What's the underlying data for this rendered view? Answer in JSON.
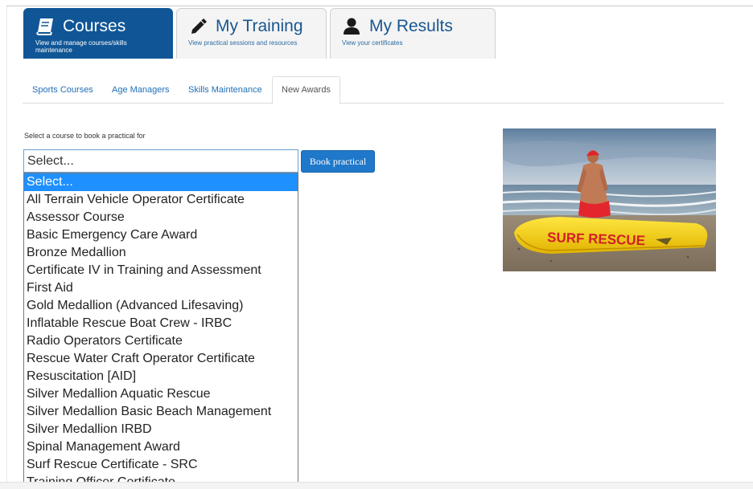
{
  "main_tabs": [
    {
      "title": "Courses",
      "subtitle": "View and manage courses/skills maintenance",
      "icon": "book-icon",
      "active": true
    },
    {
      "title": "My Training",
      "subtitle": "View practical sessions and resources",
      "icon": "pencil-icon",
      "active": false
    },
    {
      "title": "My Results",
      "subtitle": "View your certificates",
      "icon": "user-icon",
      "active": false
    }
  ],
  "sub_tabs": [
    {
      "label": "Sports Courses",
      "active": false
    },
    {
      "label": "Age Managers",
      "active": false
    },
    {
      "label": "Skills Maintenance",
      "active": false
    },
    {
      "label": "New Awards",
      "active": true
    }
  ],
  "form": {
    "prompt": "Select a course to book a practical for",
    "select_value": "Select...",
    "book_button": "Book practical"
  },
  "dropdown": {
    "options": [
      "Select...",
      "All Terrain Vehicle Operator Certificate",
      "Assessor Course",
      "Basic Emergency Care Award",
      "Bronze Medallion",
      "Certificate IV in Training and Assessment",
      "First Aid",
      "Gold Medallion (Advanced Lifesaving)",
      "Inflatable Rescue Boat Crew - IRBC",
      "Radio Operators Certificate",
      "Rescue Water Craft Operator Certificate",
      "Resuscitation [AID]",
      "Silver Medallion Aquatic Rescue",
      "Silver Medallion Basic Beach Management",
      "Silver Medallion IRBD",
      "Spinal Management Award",
      "Surf Rescue Certificate - SRC",
      "Training Officer Certificate"
    ],
    "selected_index": 0
  },
  "photo": {
    "board_text": "SURF RESCUE"
  },
  "colors": {
    "active_tab": "#105696",
    "link": "#1f6fb7",
    "button": "#1f78c9",
    "highlight": "#1e90ff"
  }
}
